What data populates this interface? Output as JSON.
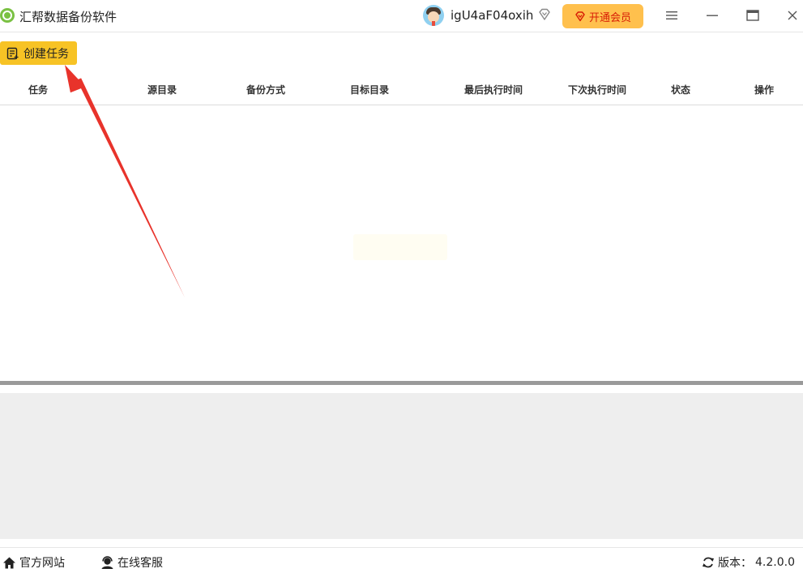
{
  "app": {
    "title": "汇帮数据备份软件"
  },
  "user": {
    "name": "igU4aF04oxih"
  },
  "vip": {
    "label": "开通会员"
  },
  "toolbar": {
    "create_label": "创建任务"
  },
  "table": {
    "columns": [
      "任务",
      "源目录",
      "备份方式",
      "目标目录",
      "最后执行时间",
      "下次执行时间",
      "状态",
      "操作"
    ],
    "rows": []
  },
  "footer": {
    "site_label": "官方网站",
    "support_label": "在线客服",
    "version_label": "版本：",
    "version_value": "4.2.0.0"
  },
  "colors": {
    "accent": "#f7c325",
    "vip_bg": "#ffc04d",
    "vip_text": "#d81e06",
    "annotation_arrow": "#e8332b",
    "log_bg": "#eeeeee"
  }
}
